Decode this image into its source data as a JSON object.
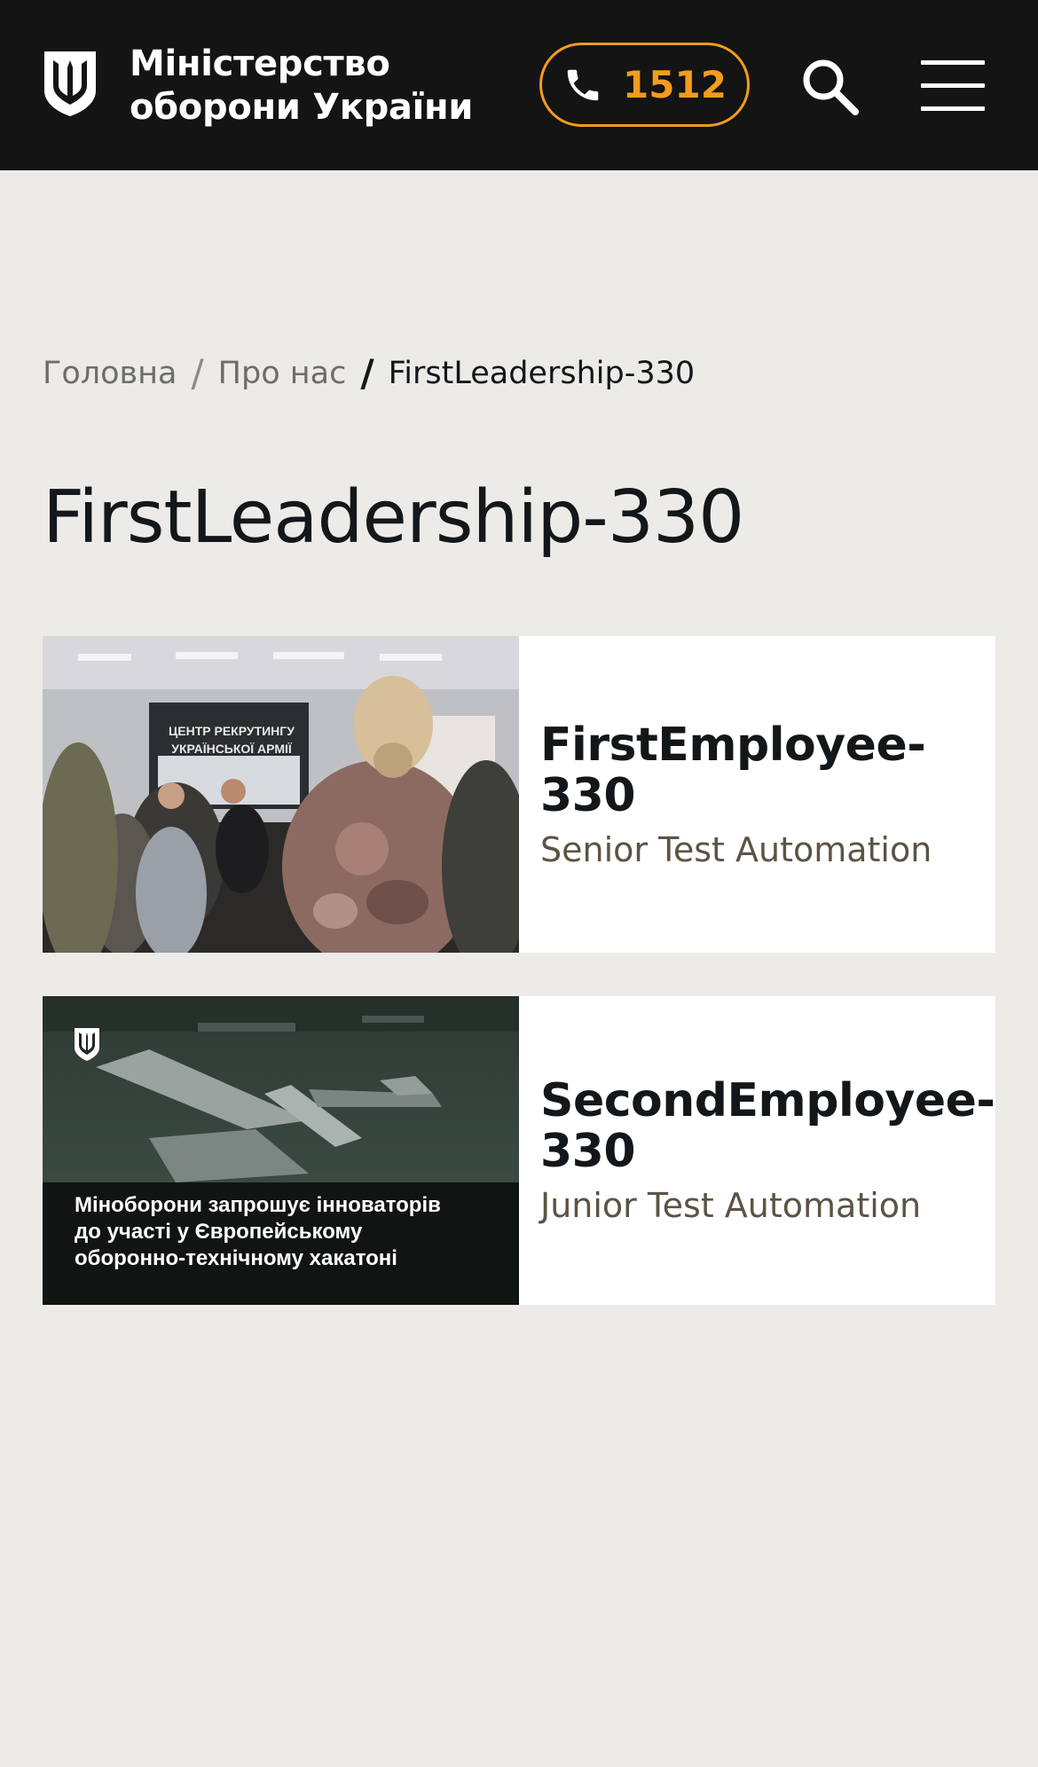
{
  "header": {
    "logo_line1": "Міністерство",
    "logo_line2": "оборони України",
    "phone": "1512",
    "accent_color": "#f39c1e",
    "background_color": "#141414",
    "icons": [
      "trident-icon",
      "phone-icon",
      "search-icon",
      "menu-icon"
    ]
  },
  "breadcrumb": {
    "items": [
      "Головна",
      "Про нас"
    ],
    "separator": "/",
    "current": "FirstLeadership-330"
  },
  "page": {
    "title": "FirstLeadership-330"
  },
  "cards": [
    {
      "name": "FirstEmployee-330",
      "role": "Senior Test Automation",
      "image_sign_line1": "ЦЕНТР РЕКРУТИНГУ",
      "image_sign_line2": "УКРАЇНСЬКОЇ АРМІЇ"
    },
    {
      "name": "SecondEmployee-330",
      "role": "Junior Test Automation",
      "image_caption_line1": "Міноборони запрошує інноваторів",
      "image_caption_line2": "до участі у Європейському",
      "image_caption_line3": "оборонно-технічному хакатоні"
    }
  ]
}
